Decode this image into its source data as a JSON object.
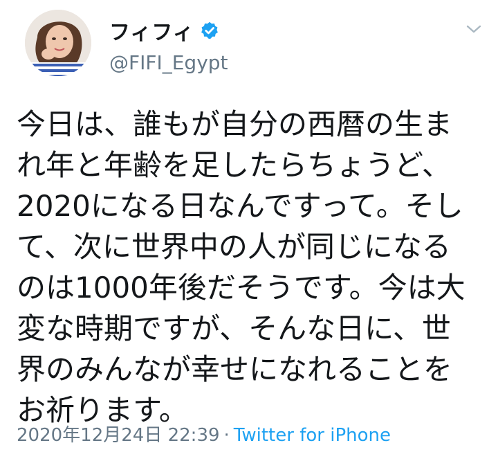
{
  "user": {
    "display_name": "フィフィ",
    "handle": "@FIFI_Egypt",
    "verified_icon": "verified-badge-icon"
  },
  "tweet": {
    "lines": [
      "今日は、誰もが自分の西暦の生ま",
      "れ年と年齢を足したらちょうど、",
      "2020になる日なんですって。そし",
      "て、次に世界中の人が同じになる",
      "のは1000年後だそうです。今は大",
      "変な時期ですが、そんな日に、世",
      "界のみんなが幸せになれることを",
      "お祈ります。"
    ]
  },
  "meta": {
    "timestamp": "2020年12月24日 22:39",
    "separator": "·",
    "source": "Twitter for iPhone"
  },
  "colors": {
    "verified": "#1da1f2",
    "secondary_text": "#657786",
    "link": "#1da1f2",
    "caret": "#aab8c2"
  }
}
